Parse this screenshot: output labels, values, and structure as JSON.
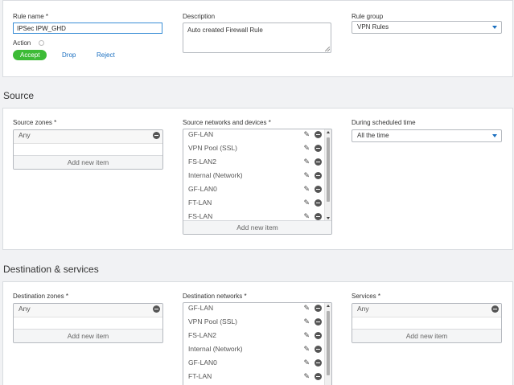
{
  "rule": {
    "name_label": "Rule name *",
    "name_value": "IPSec IPW_GHD",
    "description_label": "Description",
    "description_value": "Auto created Firewall Rule",
    "group_label": "Rule group",
    "group_value": "VPN Rules",
    "action_label": "Action",
    "actions": [
      "Accept",
      "Drop",
      "Reject"
    ],
    "active_action": "Accept"
  },
  "source": {
    "title": "Source",
    "zones_label": "Source zones *",
    "zones": [
      "Any"
    ],
    "networks_label": "Source networks and devices *",
    "networks": [
      "GF-LAN",
      "VPN Pool (SSL)",
      "FS-LAN2",
      "Internal (Network)",
      "GF-LAN0",
      "FT-LAN",
      "FS-LAN"
    ],
    "schedule_label": "During scheduled time",
    "schedule_value": "All the time",
    "add_new": "Add new item"
  },
  "destination": {
    "title": "Destination & services",
    "zones_label": "Destination zones *",
    "zones": [
      "Any"
    ],
    "networks_label": "Destination networks *",
    "networks": [
      "GF-LAN",
      "VPN Pool (SSL)",
      "FS-LAN2",
      "Internal (Network)",
      "GF-LAN0",
      "FT-LAN"
    ],
    "services_label": "Services *",
    "services": [
      "Any"
    ],
    "add_new": "Add new item"
  },
  "colors": {
    "accent": "#3dbb36",
    "link": "#1a6fc0",
    "panel_border": "#d9dce0"
  }
}
